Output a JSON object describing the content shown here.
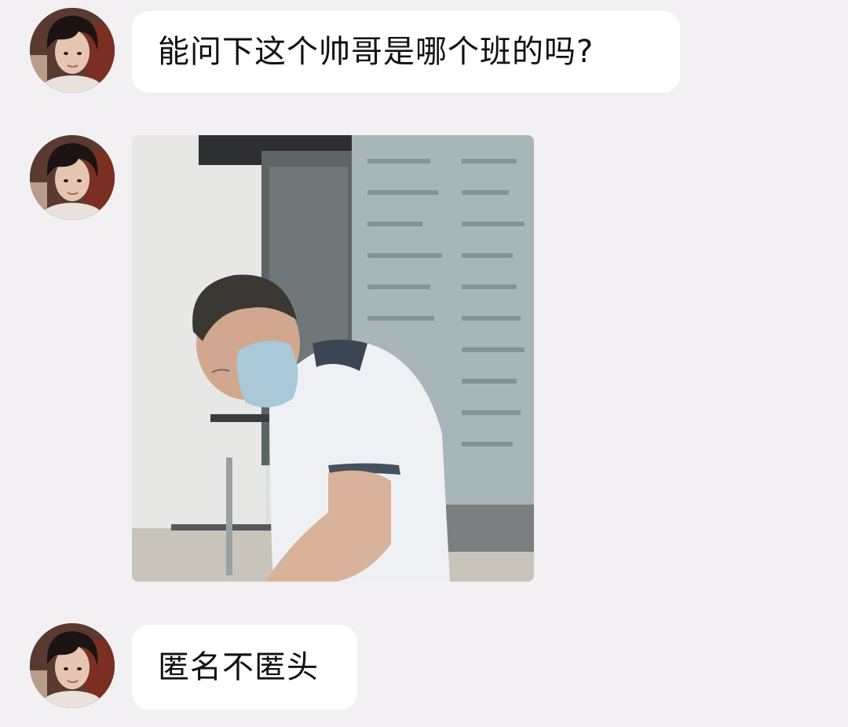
{
  "messages": [
    {
      "type": "text",
      "text": "能问下这个帅哥是哪个班的吗?"
    },
    {
      "type": "image"
    },
    {
      "type": "text",
      "text": "匿名不匿头"
    }
  ],
  "colors": {
    "background": "#F2F0F3",
    "bubble": "#FFFFFF",
    "text": "#111111"
  }
}
